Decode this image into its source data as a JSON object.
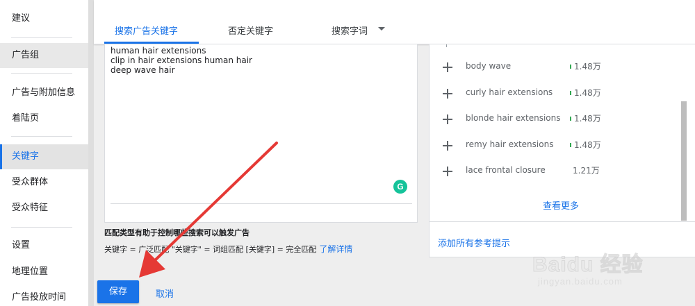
{
  "sidebar": {
    "items": [
      {
        "label": "建议"
      },
      {
        "label": "广告组"
      },
      {
        "label": "广告与附加信息"
      },
      {
        "label": "着陆页"
      },
      {
        "label": "关键字"
      },
      {
        "label": "受众群体"
      },
      {
        "label": "受众特征"
      },
      {
        "label": "设置"
      },
      {
        "label": "地理位置"
      },
      {
        "label": "广告投放时间"
      }
    ],
    "active_index": 4
  },
  "tabs": [
    {
      "label": "搜索广告关键字",
      "active": true
    },
    {
      "label": "否定关键字",
      "active": false
    },
    {
      "label": "搜索字词",
      "active": false,
      "has_dropdown": true
    }
  ],
  "editor": {
    "keywords": [
      "human hair extensions",
      "clip in hair extensions human hair",
      "deep wave hair"
    ],
    "grammarly_letter": "G"
  },
  "match_info": {
    "heading": "匹配类型有助于控制哪些搜索可以触发广告",
    "detail": "关键字 = 广泛匹配 \"关键字\" = 词组匹配  [关键字] = 完全匹配",
    "learn_more": "了解详情"
  },
  "suggestions": {
    "items": [
      {
        "keyword": "body wave",
        "volume": "1.48万",
        "trend": true
      },
      {
        "keyword": "curly hair extensions",
        "volume": "1.48万",
        "trend": true
      },
      {
        "keyword": "blonde hair extensions",
        "volume": "1.48万",
        "trend": true
      },
      {
        "keyword": "remy hair extensions",
        "volume": "1.48万",
        "trend": true
      },
      {
        "keyword": "lace frontal closure",
        "volume": "1.21万",
        "trend": false
      }
    ],
    "see_more": "查看更多",
    "add_all": "添加所有参考提示"
  },
  "footer": {
    "save": "保存",
    "cancel": "取消"
  },
  "watermark": {
    "logo": "Baidu 经验",
    "url": "jingyan.baidu.com"
  },
  "colors": {
    "accent": "#1a73e8",
    "annotation_arrow": "#e53935",
    "trend_green": "#34a853"
  }
}
